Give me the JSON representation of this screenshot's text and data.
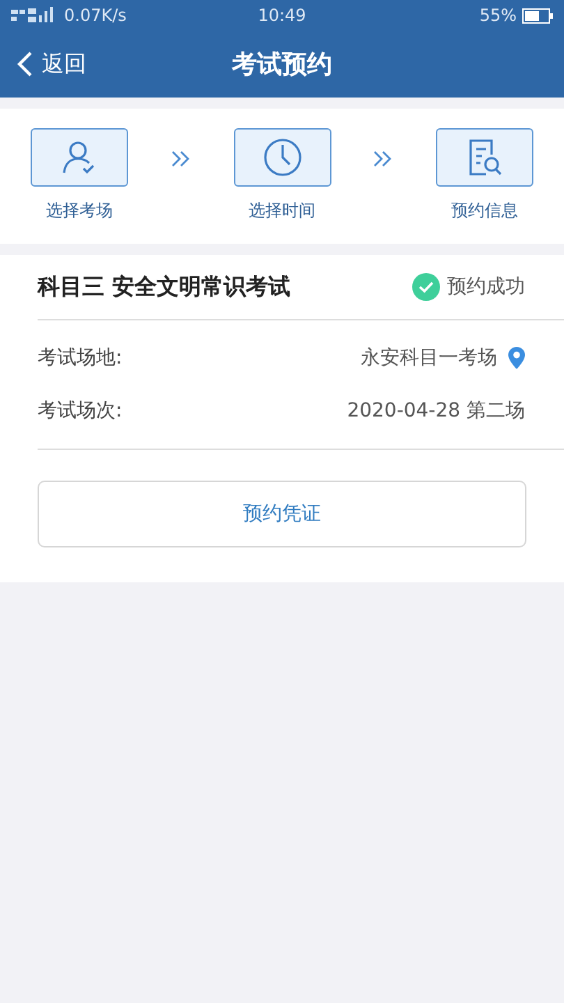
{
  "status_bar": {
    "network_speed": "0.07K/s",
    "time": "10:49",
    "battery": "55%"
  },
  "nav": {
    "back": "返回",
    "title": "考试预约"
  },
  "steps": [
    {
      "label": "选择考场"
    },
    {
      "label": "选择时间"
    },
    {
      "label": "预约信息"
    }
  ],
  "exam": {
    "title": "科目三 安全文明常识考试",
    "status": "预约成功",
    "success": true,
    "fields": [
      {
        "label": "考试场地:",
        "value": "永安科目一考场",
        "kind": "location"
      },
      {
        "label": "考试场次:",
        "value": "2020-04-28 第二场",
        "kind": "text"
      }
    ],
    "button": "预约凭证"
  }
}
